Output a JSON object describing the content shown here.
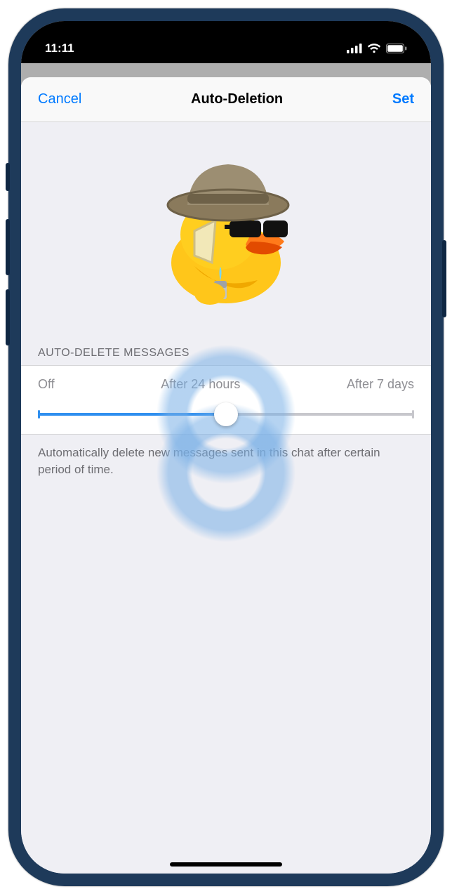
{
  "statusbar": {
    "time": "11:11"
  },
  "nav": {
    "cancel_label": "Cancel",
    "title": "Auto-Deletion",
    "set_label": "Set"
  },
  "section": {
    "header": "AUTO-DELETE MESSAGES"
  },
  "slider": {
    "options": [
      "Off",
      "After 24 hours",
      "After 7 days"
    ],
    "selected_index": 1,
    "percent": 50
  },
  "footer": {
    "text": "Automatically delete new messages sent in this chat after certain period of time."
  },
  "colors": {
    "accent": "#007aff",
    "track_active": "#2f8fef"
  },
  "icons": {
    "hero": "detective-duck-sticker",
    "signal": "cellular-signal-icon",
    "wifi": "wifi-icon",
    "battery": "battery-icon"
  }
}
